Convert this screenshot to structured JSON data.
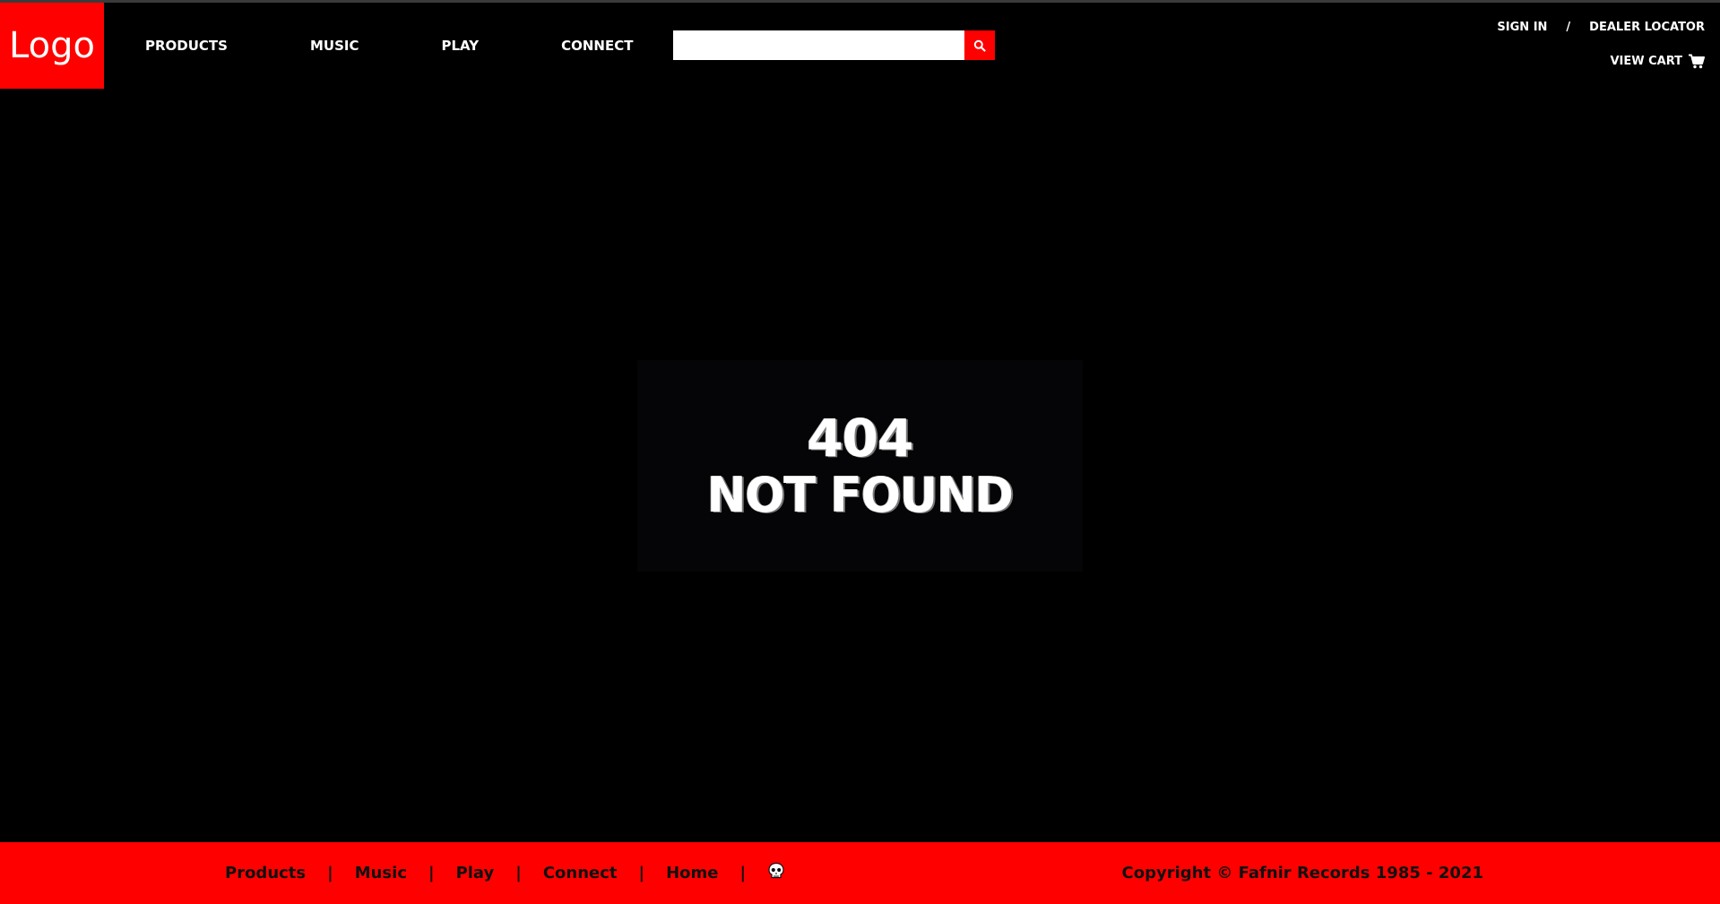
{
  "header": {
    "logo_text": "Logo",
    "nav": [
      "PRODUCTS",
      "MUSIC",
      "PLAY",
      "CONNECT"
    ],
    "search": {
      "value": "",
      "placeholder": ""
    },
    "sign_in": "SIGN IN",
    "separator": "/",
    "dealer_locator": "DEALER LOCATOR",
    "view_cart": "VIEW CART"
  },
  "main": {
    "error_code": "404",
    "error_message": "NOT FOUND"
  },
  "footer": {
    "links": [
      "Products",
      "Music",
      "Play",
      "Connect",
      "Home"
    ],
    "separator": "|",
    "copyright": "Copyright © Fafnir Records 1985 - 2021"
  },
  "colors": {
    "accent": "#ff0000",
    "background": "#000000",
    "text": "#ffffff",
    "footer_text": "#111111"
  },
  "icons": {
    "search": "search-icon",
    "cart": "cart-icon",
    "skull": "skull-icon"
  }
}
